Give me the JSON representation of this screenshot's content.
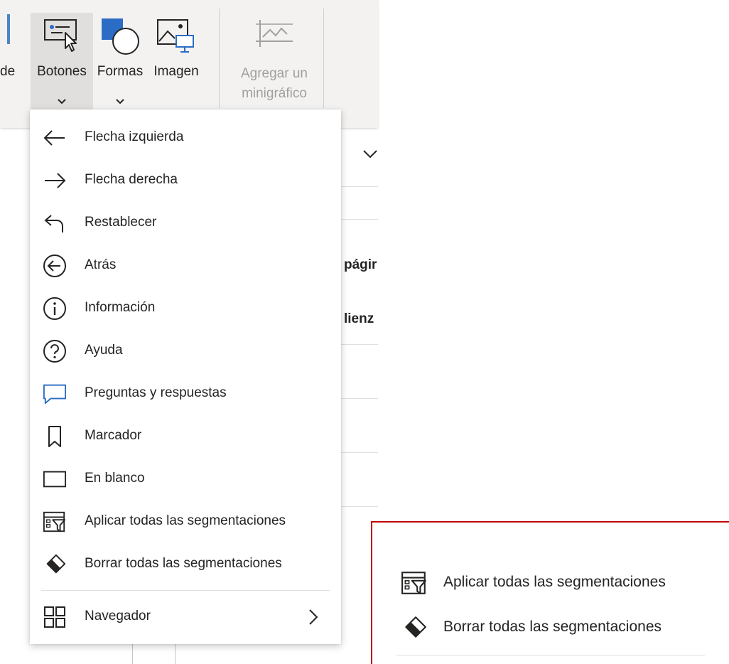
{
  "ribbon": {
    "partial_label": "de",
    "buttons": [
      {
        "label": "Botones",
        "icon": "button-cursor-icon",
        "has_dropdown": true
      },
      {
        "label": "Formas",
        "icon": "shapes-icon",
        "has_dropdown": true
      },
      {
        "label": "Imagen",
        "icon": "image-icon",
        "has_dropdown": false
      },
      {
        "label": "Agregar un minigráfico",
        "icon": "sparkline-icon",
        "has_dropdown": false,
        "disabled": true
      }
    ]
  },
  "background": {
    "partial_texts": [
      "págir",
      "lienz"
    ]
  },
  "menu": {
    "items": [
      {
        "label": "Flecha izquierda",
        "icon": "arrow-left-icon"
      },
      {
        "label": "Flecha derecha",
        "icon": "arrow-right-icon"
      },
      {
        "label": "Restablecer",
        "icon": "reset-icon"
      },
      {
        "label": "Atrás",
        "icon": "back-circle-icon"
      },
      {
        "label": "Información",
        "icon": "info-icon"
      },
      {
        "label": "Ayuda",
        "icon": "help-icon"
      },
      {
        "label": "Preguntas y respuestas",
        "icon": "qna-icon"
      },
      {
        "label": "Marcador",
        "icon": "bookmark-icon"
      },
      {
        "label": "En blanco",
        "icon": "blank-icon"
      },
      {
        "label": "Aplicar todas las segmentaciones",
        "icon": "apply-slicers-icon"
      },
      {
        "label": "Borrar todas las segmentaciones",
        "icon": "eraser-icon"
      }
    ],
    "navigator": {
      "label": "Navegador",
      "icon": "navigator-icon",
      "has_submenu": true
    }
  },
  "callout": {
    "items": [
      {
        "label": "Aplicar todas las segmentaciones",
        "icon": "apply-slicers-icon"
      },
      {
        "label": "Borrar todas las segmentaciones",
        "icon": "eraser-icon"
      }
    ]
  },
  "colors": {
    "accent": "#2b6cc4",
    "callout_border": "#c00000",
    "text": "#252423"
  }
}
